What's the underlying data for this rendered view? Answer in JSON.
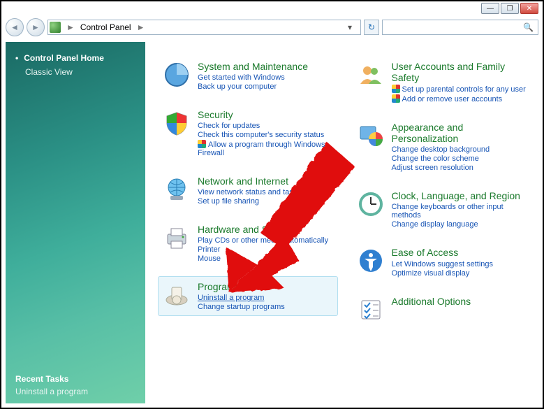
{
  "window": {
    "minimize": "—",
    "maximize": "❐",
    "close": "✕"
  },
  "toolbar": {
    "back": "◄",
    "forward": "►",
    "breadcrumb_root": "Control Panel",
    "breadcrumb_sep": "►",
    "dropdown": "▾",
    "refresh": "↻",
    "search_placeholder": "",
    "search_icon": "🔍"
  },
  "sidebar": {
    "home": "Control Panel Home",
    "classic": "Classic View",
    "recent_heading": "Recent Tasks",
    "recent_item": "Uninstall a program"
  },
  "left_col": [
    {
      "title": "System and Maintenance",
      "links": [
        "Get started with Windows",
        "Back up your computer"
      ],
      "icon": "system"
    },
    {
      "title": "Security",
      "links": [
        "Check for updates",
        "Check this computer's security status"
      ],
      "shield_link": "Allow a program through Windows Firewall",
      "icon": "shield"
    },
    {
      "title": "Network and Internet",
      "links": [
        "View network status and tasks",
        "Set up file sharing"
      ],
      "icon": "network"
    },
    {
      "title": "Hardware and Sound",
      "links": [
        "Play CDs or other media automatically",
        "Printer",
        "Mouse"
      ],
      "icon": "hardware"
    },
    {
      "title": "Programs",
      "links_u": [
        "Uninstall a program"
      ],
      "links": [
        "Change startup programs"
      ],
      "icon": "programs",
      "highlight": true
    }
  ],
  "right_col": [
    {
      "title": "User Accounts and Family Safety",
      "shield_link": "Set up parental controls for any user",
      "shield_link2": "Add or remove user accounts",
      "links": [],
      "icon": "users"
    },
    {
      "title": "Appearance and Personalization",
      "links": [
        "Change desktop background",
        "Change the color scheme",
        "Adjust screen resolution"
      ],
      "icon": "appearance"
    },
    {
      "title": "Clock, Language, and Region",
      "links": [
        "Change keyboards or other input methods",
        "Change display language"
      ],
      "icon": "clock"
    },
    {
      "title": "Ease of Access",
      "links": [
        "Let Windows suggest settings",
        "Optimize visual display"
      ],
      "icon": "ease"
    },
    {
      "title": "Additional Options",
      "links": [],
      "icon": "additional"
    }
  ]
}
